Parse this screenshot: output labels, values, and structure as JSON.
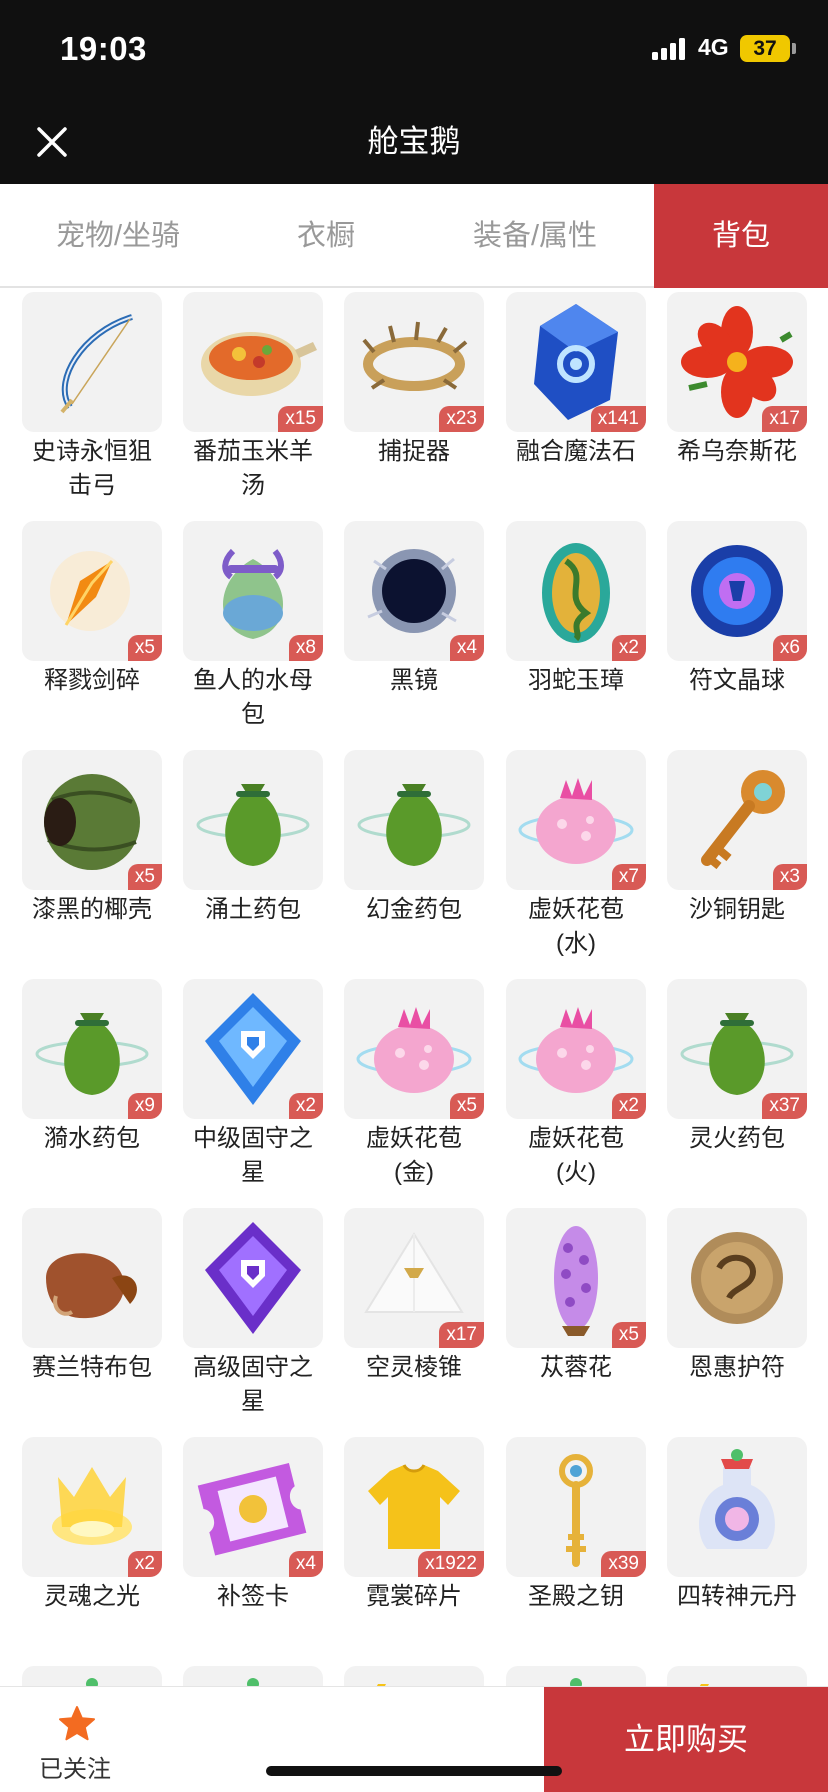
{
  "status_bar": {
    "time": "19:03",
    "network": "4G",
    "battery": "37"
  },
  "nav": {
    "title": "舱宝鹅"
  },
  "tabs": [
    {
      "label": "宠物/坐骑",
      "active": false
    },
    {
      "label": "衣橱",
      "active": false
    },
    {
      "label": "装备/属性",
      "active": false
    },
    {
      "label": "背包",
      "active": true
    }
  ],
  "items": [
    {
      "name": "史诗永恒狙\n击弓",
      "count": "",
      "icon": "bow-icon"
    },
    {
      "name": "番茄玉米羊\n汤",
      "count": "x15",
      "icon": "soup-bowl-icon"
    },
    {
      "name": "捕捉器",
      "count": "x23",
      "icon": "thorn-ring-icon"
    },
    {
      "name": "融合魔法石",
      "count": "x141",
      "icon": "blue-crystal-icon"
    },
    {
      "name": "希乌奈斯花",
      "count": "x17",
      "icon": "red-flower-icon"
    },
    {
      "name": "释戮剑碎",
      "count": "x5",
      "icon": "sword-shard-icon"
    },
    {
      "name": "鱼人的水母\n包",
      "count": "x8",
      "icon": "jellyfish-bag-icon"
    },
    {
      "name": "黑镜",
      "count": "x4",
      "icon": "black-mirror-icon"
    },
    {
      "name": "羽蛇玉璋",
      "count": "x2",
      "icon": "serpent-jade-icon"
    },
    {
      "name": "符文晶球",
      "count": "x6",
      "icon": "rune-orb-icon"
    },
    {
      "name": "漆黑的椰壳",
      "count": "x5",
      "icon": "coconut-shell-icon"
    },
    {
      "name": "涌土药包",
      "count": "",
      "icon": "green-pouch-icon"
    },
    {
      "name": "幻金药包",
      "count": "",
      "icon": "green-pouch-icon"
    },
    {
      "name": "虚妖花苞\n(水)",
      "count": "x7",
      "icon": "pink-bud-icon"
    },
    {
      "name": "沙铜钥匙",
      "count": "x3",
      "icon": "bronze-key-icon"
    },
    {
      "name": "漪水药包",
      "count": "x9",
      "icon": "green-pouch-icon"
    },
    {
      "name": "中级固守之\n星",
      "count": "x2",
      "icon": "blue-shield-gem-icon"
    },
    {
      "name": "虚妖花苞\n(金)",
      "count": "x5",
      "icon": "pink-bud-icon"
    },
    {
      "name": "虚妖花苞\n(火)",
      "count": "x2",
      "icon": "pink-bud-icon"
    },
    {
      "name": "灵火药包",
      "count": "x37",
      "icon": "green-pouch-icon"
    },
    {
      "name": "赛兰特布包",
      "count": "",
      "icon": "leather-pouch-icon"
    },
    {
      "name": "高级固守之\n星",
      "count": "",
      "icon": "purple-shield-gem-icon"
    },
    {
      "name": "空灵棱锥",
      "count": "x17",
      "icon": "white-pyramid-icon"
    },
    {
      "name": "苁蓉花",
      "count": "x5",
      "icon": "purple-flower-spike-icon"
    },
    {
      "name": "恩惠护符",
      "count": "",
      "icon": "stone-amulet-icon"
    },
    {
      "name": "灵魂之光",
      "count": "x2",
      "icon": "golden-light-icon"
    },
    {
      "name": "补签卡",
      "count": "x4",
      "icon": "ticket-card-icon"
    },
    {
      "name": "霓裳碎片",
      "count": "x1922",
      "icon": "yellow-shirt-icon"
    },
    {
      "name": "圣殿之钥",
      "count": "x39",
      "icon": "golden-scepter-icon"
    },
    {
      "name": "四转神元丹",
      "count": "",
      "icon": "potion-flask-icon"
    },
    {
      "name": "",
      "count": "",
      "icon": "potion-flask-icon"
    },
    {
      "name": "",
      "count": "",
      "icon": "potion-flask-icon"
    },
    {
      "name": "",
      "count": "",
      "icon": "lightning-potion-icon"
    },
    {
      "name": "",
      "count": "",
      "icon": "potion-flask-icon"
    },
    {
      "name": "",
      "count": "",
      "icon": "lightning-potion-icon"
    }
  ],
  "bottom": {
    "follow_label": "已关注",
    "buy_label": "立即购买"
  },
  "colors": {
    "accent": "#c8373b",
    "count_badge": "#d85a55",
    "header": "#101010"
  }
}
